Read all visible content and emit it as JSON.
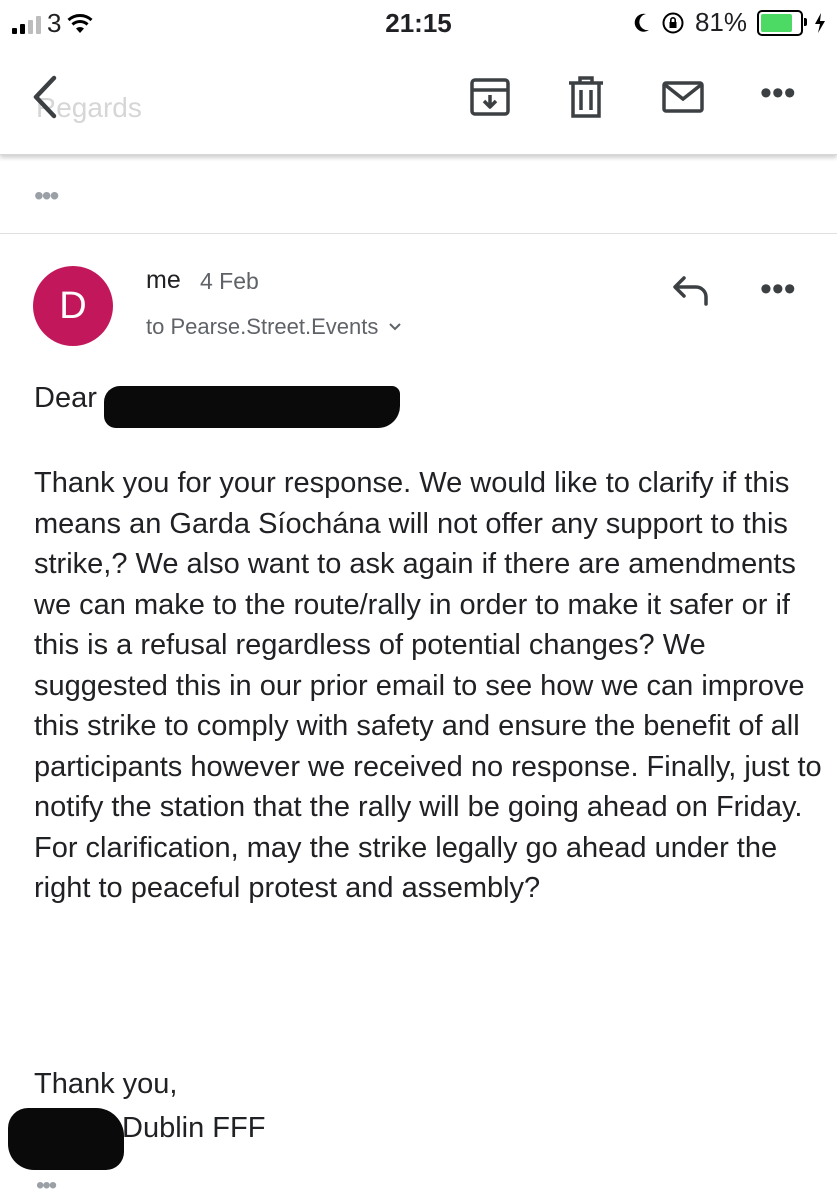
{
  "status_bar": {
    "carrier": "3",
    "time": "21:15",
    "battery_percent": "81%",
    "battery_level": 0.81
  },
  "toolbar": {
    "faded_subject": "Regards",
    "icons": [
      "back-icon",
      "archive-icon",
      "trash-icon",
      "mail-icon",
      "more-icon"
    ],
    "more_label": "•••"
  },
  "thread": {
    "collapsed_label": "•••"
  },
  "message": {
    "avatar_letter": "D",
    "avatar_color": "#c2185b",
    "sender": "me",
    "date": "4 Feb",
    "recipient": "to Pearse.Street.Events",
    "greeting": "Dear",
    "body": "Thank you for your response. We would like to clarify if this means an Garda Síochána will not offer any support to this strike,? We also want to ask again if there are amendments we can make to the route/rally in order to make it safer or if this is a refusal regardless of potential changes? We suggested this in our prior email to see how we can improve this strike to comply with safety and ensure the benefit of all participants however we received no response. Finally, just to notify the station that the rally will be going ahead on Friday. For clarification, may the strike legally go ahead under the right to peaceful protest and assembly?",
    "closing": "Thank you,",
    "signature": "Dublin FFF",
    "more_label": "•••",
    "quoted_label": "•••"
  }
}
